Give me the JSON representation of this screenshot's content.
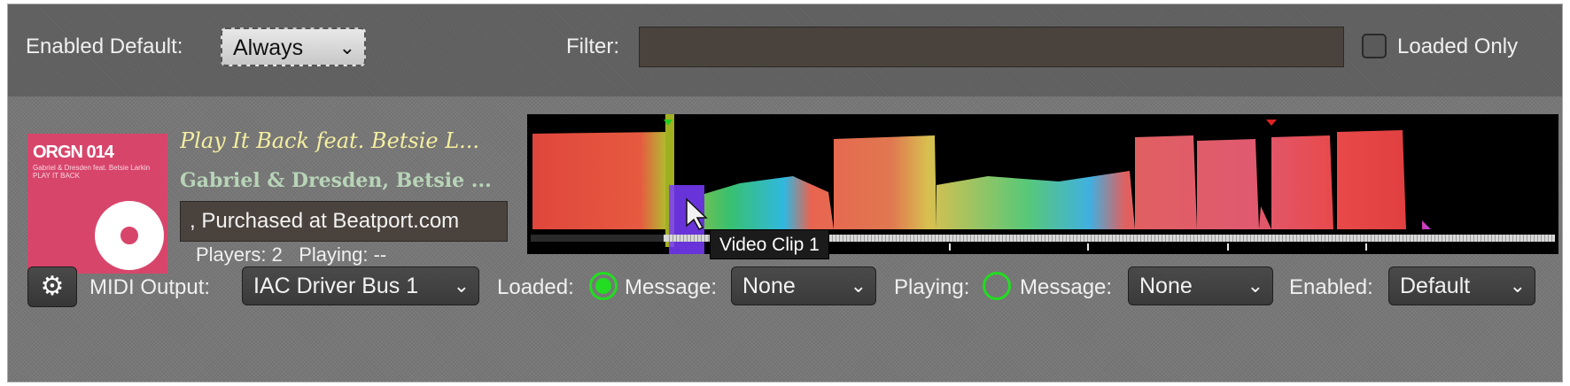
{
  "top_bar": {
    "enabled_default_label": "Enabled Default:",
    "enabled_default_value": "Always",
    "filter_label": "Filter:",
    "filter_value": "",
    "loaded_only_label": "Loaded Only",
    "loaded_only_checked": false
  },
  "track": {
    "artwork": {
      "title": "ORGN 014",
      "small_text": "Gabriel & Dresden feat. Betsie Larkin\nPLAY IT BACK",
      "accent": "#d8456b"
    },
    "title": "Play It Back feat. Betsie L...",
    "artist": "Gabriel & Dresden, Betsie ...",
    "comment": ", Purchased at Beatport.com",
    "players_label": "Players:",
    "players_value": "2",
    "playing_label": "Playing:",
    "playing_value": "--"
  },
  "waveform": {
    "tooltip": "Video Clip 1",
    "cue_marker_color": "#22cc22",
    "loop_marker_color": "#dd2222",
    "cue_region_color": "#7a3cff"
  },
  "controls": {
    "gear_icon": "gear-icon",
    "midi_output_label": "MIDI Output:",
    "midi_output_value": "IAC Driver Bus 1",
    "loaded_label": "Loaded:",
    "loaded_state": true,
    "loaded_message_label": "Message:",
    "loaded_message_value": "None",
    "playing_label": "Playing:",
    "playing_state": false,
    "playing_message_label": "Message:",
    "playing_message_value": "None",
    "enabled_label": "Enabled:",
    "enabled_value": "Default",
    "indicator_color": "#22dd22"
  }
}
